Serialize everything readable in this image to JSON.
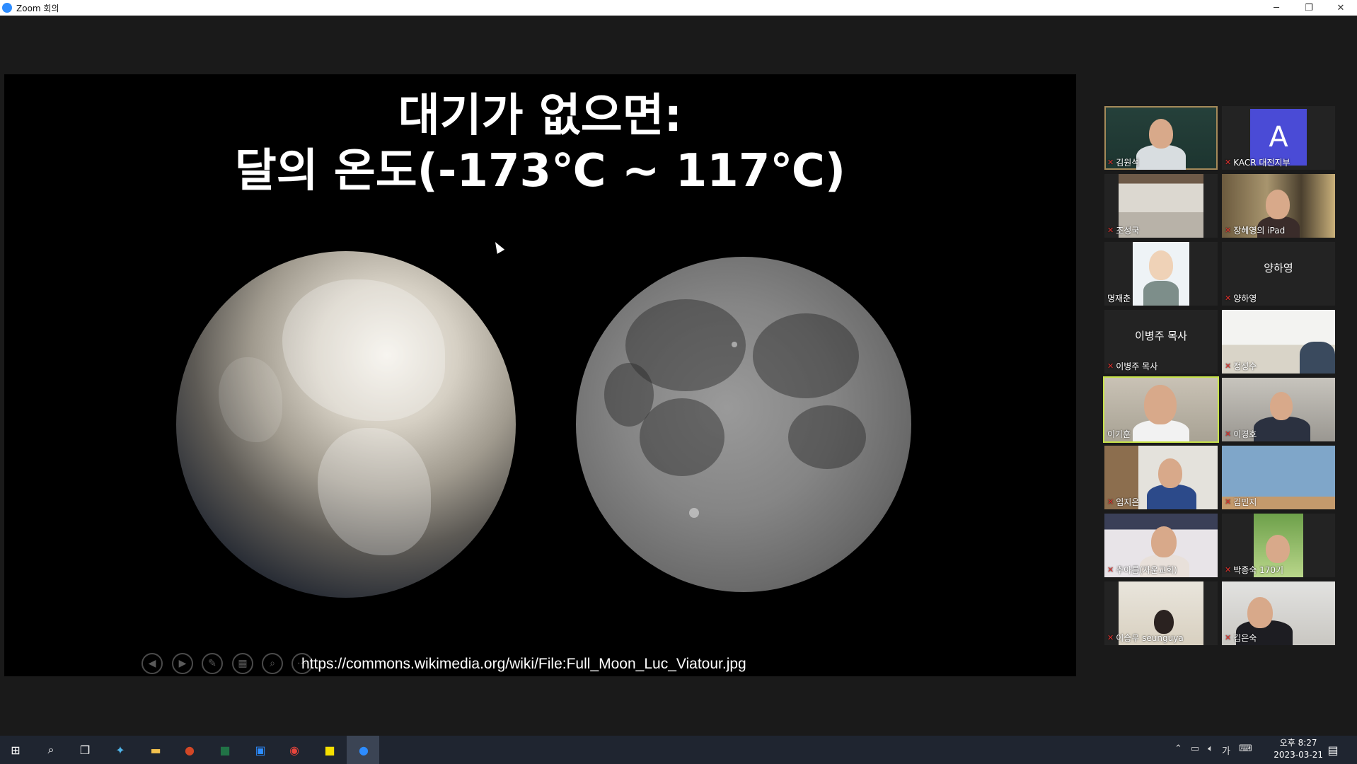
{
  "window": {
    "title": "Zoom 회의",
    "minimize": "─",
    "restore": "❐",
    "close": "✕"
  },
  "slide": {
    "title_line1": "대기가 없으면:",
    "title_line2": "달의 온도(-173℃ ~ 117℃)",
    "url": "https://commons.wikimedia.org/wiki/File:Full_Moon_Luc_Viatour.jpg",
    "controls": [
      "◀",
      "▶",
      "✎",
      "▦",
      "⌕",
      "⋯"
    ]
  },
  "participants": [
    {
      "name": "김원석",
      "muted": true,
      "type": "video"
    },
    {
      "name": "KACR 대전지부",
      "muted": true,
      "type": "avatar",
      "initial": "A"
    },
    {
      "name": "조성국",
      "muted": true,
      "type": "video"
    },
    {
      "name": "장혜영의 iPad",
      "muted": true,
      "type": "video"
    },
    {
      "name": "명재춘",
      "muted": false,
      "type": "video"
    },
    {
      "name": "양하영",
      "muted": true,
      "type": "name",
      "display": "양하영"
    },
    {
      "name": "이병주 목사",
      "muted": true,
      "type": "name",
      "display": "이병주 목사"
    },
    {
      "name": "정성수",
      "muted": true,
      "type": "video"
    },
    {
      "name": "이기훈",
      "muted": false,
      "type": "video",
      "active_speaker": true
    },
    {
      "name": "이경호",
      "muted": true,
      "type": "video"
    },
    {
      "name": "임지은",
      "muted": true,
      "type": "video"
    },
    {
      "name": "김민지",
      "muted": true,
      "type": "video"
    },
    {
      "name": "추아름(자운교회)",
      "muted": true,
      "type": "video"
    },
    {
      "name": "박종숙 170기",
      "muted": true,
      "type": "video"
    },
    {
      "name": "이승우 seunguya",
      "muted": true,
      "type": "video"
    },
    {
      "name": "김은숙",
      "muted": true,
      "type": "video"
    }
  ],
  "mute_icon": "mic-muted",
  "taskbar": {
    "time_line1": "오후 8:27",
    "time_line2": "2023-03-21",
    "ime": "가",
    "apps": [
      "windows-start",
      "search",
      "task-view",
      "bird-app",
      "file-explorer",
      "powerpoint",
      "excel",
      "screen-app",
      "chrome",
      "kakaotalk",
      "zoom"
    ]
  },
  "colors": {
    "active_speaker": "#c7e24a",
    "mute_red": "#e0322e",
    "avatar_blue": "#4a4bd6",
    "zoom_blue": "#2d8cff"
  }
}
